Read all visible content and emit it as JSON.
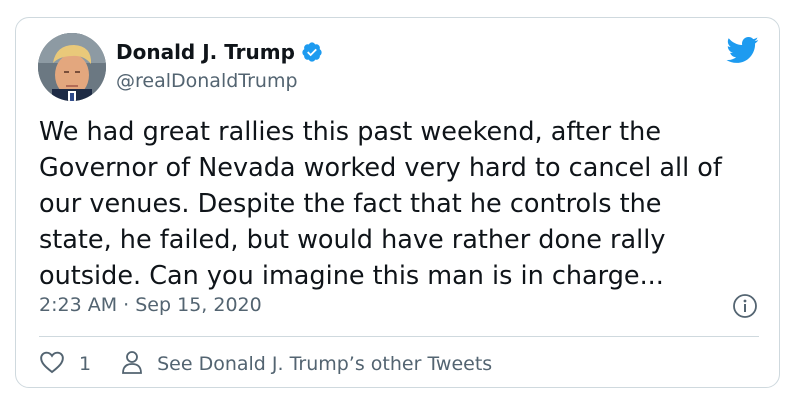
{
  "user": {
    "name": "Donald J. Trump",
    "handle": "@realDonaldTrump",
    "verified_color": "#1d9bf0"
  },
  "tweet": {
    "text": "We had great rallies this past weekend, after the\nGovernor of Nevada worked very hard to cancel all of\nour venues. Despite the fact that he controls the\nstate, he failed, but would have rather done rally\noutside. Can you imagine this man is in charge...",
    "time": "2:23 AM",
    "separator": "·",
    "date": "Sep 15, 2020"
  },
  "actions": {
    "like_count": "1",
    "other_tweets_label": "See Donald J. Trump’s other Tweets"
  },
  "icons": {
    "logo": "twitter-bird-icon",
    "info": "info-icon",
    "like": "heart-icon",
    "profile": "person-icon",
    "verified": "verified-badge-icon"
  },
  "colors": {
    "twitter_blue": "#1d9bf0",
    "text": "#0f1419",
    "secondary": "#536471",
    "border": "#cfd9de"
  }
}
